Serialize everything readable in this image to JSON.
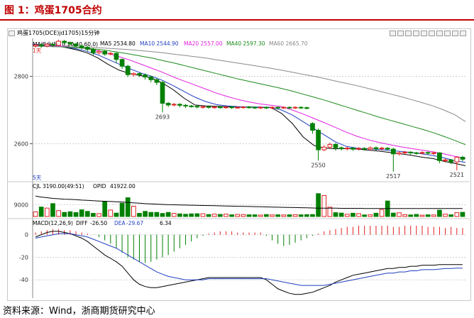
{
  "figure_title": "图 1：鸡蛋1705合约",
  "source_text": "资料来源：Wind，浙商期货研究中心",
  "toolbar": {
    "label": "鸡蛋1705(DCE)jd1705)15分钟"
  },
  "main_panel": {
    "ma_group_label": "MA组合(5,10,20,40,60,0)",
    "ma_items": [
      {
        "label": "MA5 2534.80",
        "color": "#000000"
      },
      {
        "label": "MA10 2544.90",
        "color": "#1f3fbf"
      },
      {
        "label": "MA20 2557.00",
        "color": "#e020e0"
      },
      {
        "label": "MA40 2597.30",
        "color": "#1a8a1a"
      },
      {
        "label": "MA60 2665.70",
        "color": "#8a8a8a"
      }
    ],
    "flag_label": "1天",
    "annotations": [
      "2693",
      "2550",
      "2517",
      "2521"
    ],
    "period_label": "5天"
  },
  "volume_panel": {
    "label": "CJL 3190.00(49:51)",
    "opid_label": "OPID",
    "opid_value": "41922.00"
  },
  "macd_panel": {
    "label": "MACD(12,26,9)",
    "diff_label": "DIFF",
    "diff_value": "-26.50",
    "dea_label": "DEA",
    "dea_value": "-29.67",
    "macd_value": "6.34"
  },
  "colors": {
    "up": "#e02020",
    "down": "#008000",
    "title": "#c00000"
  },
  "chart_data": [
    {
      "type": "candlestick",
      "title": "",
      "y_ticks": [
        2600,
        2800
      ],
      "ylim": [
        2500,
        2900
      ],
      "candles": [
        [
          2890,
          2893,
          2885,
          2896
        ],
        [
          2893,
          2890,
          2884,
          2897
        ],
        [
          2890,
          2895,
          2886,
          2899
        ],
        [
          2895,
          2892,
          2887,
          2898
        ],
        [
          2892,
          2904,
          2890,
          2909
        ],
        [
          2904,
          2900,
          2895,
          2908
        ],
        [
          2900,
          2896,
          2891,
          2903
        ],
        [
          2896,
          2890,
          2885,
          2899
        ],
        [
          2890,
          2886,
          2880,
          2894
        ],
        [
          2886,
          2880,
          2874,
          2890
        ],
        [
          2880,
          2870,
          2863,
          2884
        ],
        [
          2870,
          2874,
          2865,
          2879
        ],
        [
          2874,
          2866,
          2861,
          2878
        ],
        [
          2866,
          2868,
          2862,
          2872
        ],
        [
          2868,
          2850,
          2840,
          2871
        ],
        [
          2850,
          2830,
          2822,
          2853
        ],
        [
          2830,
          2805,
          2798,
          2834
        ],
        [
          2805,
          2808,
          2799,
          2812
        ],
        [
          2808,
          2804,
          2798,
          2811
        ],
        [
          2804,
          2798,
          2790,
          2808
        ],
        [
          2798,
          2790,
          2782,
          2802
        ],
        [
          2790,
          2782,
          2774,
          2794
        ],
        [
          2782,
          2720,
          2693,
          2786
        ],
        [
          2720,
          2715,
          2709,
          2724
        ],
        [
          2715,
          2717,
          2711,
          2721
        ],
        [
          2717,
          2714,
          2708,
          2720
        ],
        [
          2714,
          2712,
          2706,
          2718
        ],
        [
          2712,
          2711,
          2707,
          2715
        ],
        [
          2711,
          2709,
          2705,
          2714
        ],
        [
          2709,
          2710,
          2704,
          2713
        ],
        [
          2710,
          2708,
          2704,
          2713
        ],
        [
          2708,
          2709,
          2704,
          2712
        ],
        [
          2709,
          2708,
          2704,
          2712
        ],
        [
          2708,
          2709,
          2704,
          2712
        ],
        [
          2709,
          2708,
          2703,
          2712
        ],
        [
          2708,
          2708,
          2704,
          2711
        ],
        [
          2708,
          2709,
          2704,
          2712
        ],
        [
          2709,
          2708,
          2704,
          2712
        ],
        [
          2708,
          2707,
          2703,
          2711
        ],
        [
          2707,
          2708,
          2703,
          2711
        ],
        [
          2708,
          2707,
          2703,
          2711
        ],
        [
          2707,
          2708,
          2703,
          2711
        ],
        [
          2708,
          2707,
          2703,
          2711
        ],
        [
          2707,
          2708,
          2703,
          2711
        ],
        [
          2708,
          2707,
          2703,
          2711
        ],
        [
          2707,
          2708,
          2703,
          2711
        ],
        [
          2708,
          2707,
          2703,
          2711
        ],
        [
          2707,
          2706,
          2702,
          2710
        ],
        [
          2660,
          2640,
          2630,
          2664
        ],
        [
          2640,
          2582,
          2550,
          2645
        ],
        [
          2582,
          2590,
          2578,
          2596
        ],
        [
          2590,
          2598,
          2585,
          2603
        ],
        [
          2598,
          2588,
          2580,
          2602
        ],
        [
          2588,
          2585,
          2580,
          2592
        ],
        [
          2585,
          2587,
          2580,
          2591
        ],
        [
          2587,
          2584,
          2579,
          2590
        ],
        [
          2584,
          2586,
          2580,
          2590
        ],
        [
          2586,
          2584,
          2580,
          2590
        ],
        [
          2584,
          2588,
          2580,
          2592
        ],
        [
          2588,
          2585,
          2580,
          2592
        ],
        [
          2585,
          2587,
          2580,
          2591
        ],
        [
          2587,
          2584,
          2580,
          2590
        ],
        [
          2584,
          2570,
          2517,
          2588
        ],
        [
          2570,
          2573,
          2565,
          2578
        ],
        [
          2573,
          2575,
          2568,
          2579
        ],
        [
          2575,
          2573,
          2568,
          2578
        ],
        [
          2573,
          2572,
          2568,
          2576
        ],
        [
          2572,
          2574,
          2568,
          2578
        ],
        [
          2574,
          2572,
          2567,
          2577
        ],
        [
          2572,
          2573,
          2567,
          2577
        ],
        [
          2573,
          2550,
          2542,
          2575
        ],
        [
          2550,
          2552,
          2545,
          2557
        ],
        [
          2552,
          2546,
          2540,
          2555
        ],
        [
          2546,
          2560,
          2521,
          2563
        ],
        [
          2560,
          2554,
          2548,
          2564
        ]
      ],
      "ma_series": [
        {
          "name": "MA5",
          "color": "#000000",
          "values": [
            2895,
            2893,
            2891,
            2886,
            2879,
            2870,
            2855,
            2835,
            2818,
            2808,
            2802,
            2795,
            2780,
            2760,
            2735,
            2715,
            2712,
            2711,
            2710,
            2709,
            2709,
            2708,
            2708,
            2690,
            2660,
            2620,
            2595,
            2587,
            2585,
            2586,
            2584,
            2581,
            2578,
            2574,
            2570,
            2566,
            2560,
            2556,
            2548,
            2542,
            2534.8
          ]
        },
        {
          "name": "MA10",
          "color": "#1f3fbf",
          "values": [
            2894,
            2892,
            2890,
            2887,
            2882,
            2874,
            2864,
            2850,
            2836,
            2822,
            2810,
            2800,
            2788,
            2772,
            2755,
            2738,
            2725,
            2716,
            2712,
            2710,
            2709,
            2709,
            2708,
            2700,
            2685,
            2665,
            2645,
            2625,
            2605,
            2592,
            2587,
            2585,
            2583,
            2580,
            2577,
            2574,
            2570,
            2565,
            2558,
            2550,
            2544.9
          ]
        },
        {
          "name": "MA20",
          "color": "#e020e0",
          "values": [
            2892,
            2891,
            2890,
            2889,
            2886,
            2882,
            2876,
            2868,
            2858,
            2848,
            2836,
            2824,
            2812,
            2798,
            2786,
            2774,
            2762,
            2750,
            2740,
            2731,
            2724,
            2718,
            2714,
            2710,
            2700,
            2688,
            2675,
            2662,
            2648,
            2634,
            2622,
            2612,
            2604,
            2597,
            2591,
            2586,
            2581,
            2576,
            2570,
            2563,
            2557
          ]
        },
        {
          "name": "MA40",
          "color": "#1a8a1a",
          "values": [
            2890,
            2889,
            2888,
            2887,
            2885,
            2883,
            2880,
            2876,
            2871,
            2866,
            2860,
            2854,
            2847,
            2840,
            2832,
            2824,
            2816,
            2808,
            2800,
            2792,
            2785,
            2778,
            2771,
            2764,
            2756,
            2747,
            2738,
            2729,
            2719,
            2709,
            2699,
            2689,
            2679,
            2670,
            2661,
            2652,
            2643,
            2633,
            2622,
            2610,
            2597.3
          ]
        },
        {
          "name": "MA60",
          "color": "#8a8a8a",
          "values": [
            2889,
            2889,
            2888,
            2888,
            2887,
            2886,
            2885,
            2883,
            2881,
            2879,
            2876,
            2873,
            2870,
            2866,
            2862,
            2858,
            2854,
            2849,
            2844,
            2839,
            2834,
            2829,
            2824,
            2818,
            2812,
            2806,
            2800,
            2793,
            2786,
            2779,
            2772,
            2764,
            2756,
            2748,
            2740,
            2731,
            2722,
            2712,
            2700,
            2686,
            2665.7
          ]
        }
      ]
    },
    {
      "type": "bar",
      "title": "",
      "y_ticks": [
        9000
      ],
      "ylim": [
        0,
        20000
      ],
      "volumes": [
        3500,
        7200,
        6400,
        9800,
        4500,
        3100,
        3600,
        3000,
        5100,
        3900,
        2400,
        2200,
        11200,
        4900,
        2600,
        10100,
        14300,
        7800,
        2400,
        3900,
        3100,
        3100,
        2300,
        3100,
        2400,
        2000,
        1700,
        2000,
        2100,
        2100,
        1500,
        1800,
        1600,
        1800,
        1300,
        1600,
        1500,
        1300,
        1300,
        1100,
        1500,
        1200,
        1300,
        1200,
        1300,
        1400,
        1300,
        1400,
        1500,
        17400,
        16000,
        7100,
        2900,
        2600,
        1700,
        2500,
        2200,
        1200,
        1300,
        2500,
        5300,
        11800,
        2600,
        2800,
        1400,
        1200,
        1600,
        1000,
        1300,
        1200,
        4800,
        1800,
        1300,
        2900,
        3190
      ],
      "opid": [
        15500,
        14800,
        14300,
        13800,
        13500,
        13200,
        13000,
        12800,
        12500,
        12300,
        12000,
        11800,
        11600,
        11400,
        11200,
        11000,
        10700,
        10400,
        10100,
        9800,
        9600,
        9400,
        9200,
        9000,
        8900,
        8800,
        8700,
        8600,
        8500,
        8400,
        8300,
        8200,
        8100,
        8000,
        7900,
        7800,
        7700,
        7600,
        7500,
        7400,
        7300,
        7200,
        7100,
        7000,
        6900,
        6800,
        6700,
        6600,
        6500,
        6400,
        6300,
        6300,
        6300,
        6200,
        6200,
        6200,
        6200,
        6100,
        6100,
        6100,
        6100,
        6100,
        6100,
        6100,
        6100,
        6100,
        6100,
        6100,
        6100,
        6100,
        6100,
        6100,
        6100,
        6100,
        6100
      ]
    },
    {
      "type": "line",
      "title": "",
      "y_ticks": [
        0,
        -20,
        -40
      ],
      "ylim": [
        -55,
        8
      ],
      "hist": [
        2,
        3,
        4,
        5,
        5,
        4,
        4,
        3,
        2,
        1,
        0,
        -2,
        -5,
        -8,
        -12,
        -16,
        -20,
        -22,
        -24,
        -25,
        -24,
        -22,
        -20,
        -18,
        -15,
        -12,
        -9,
        -6,
        -3,
        -1,
        1,
        2,
        3,
        3,
        3,
        2,
        2,
        2,
        2,
        2,
        -1,
        -5,
        -8,
        -10,
        -9,
        -7,
        -5,
        -3,
        -1,
        1,
        3,
        4,
        5,
        6,
        7,
        7,
        8,
        8,
        8,
        8,
        8,
        8,
        7,
        7,
        8,
        8,
        8,
        8,
        7,
        7,
        7,
        6,
        7,
        6,
        6
      ],
      "diff": [
        -2,
        0,
        2,
        3,
        3,
        2,
        1,
        -1,
        -3,
        -6,
        -10,
        -14,
        -18,
        -21,
        -24,
        -28,
        -34,
        -40,
        -44,
        -46,
        -47,
        -47,
        -46,
        -45,
        -44,
        -43,
        -42,
        -41,
        -40,
        -39,
        -38,
        -38,
        -38,
        -38,
        -38,
        -38,
        -38,
        -38,
        -38,
        -38,
        -40,
        -44,
        -48,
        -50,
        -52,
        -53,
        -53,
        -52,
        -51,
        -49,
        -47,
        -45,
        -42,
        -40,
        -38,
        -36,
        -35,
        -34,
        -33,
        -32,
        -31,
        -30,
        -30,
        -29,
        -29,
        -28,
        -28,
        -27,
        -27,
        -27,
        -26.5,
        -26.5,
        -26.5,
        -26.5,
        -26.5
      ],
      "dea": [
        -3,
        -2,
        -1,
        0,
        1,
        1,
        1,
        0,
        -1,
        -2,
        -4,
        -6,
        -8,
        -10,
        -12,
        -15,
        -18,
        -21,
        -24,
        -27,
        -30,
        -33,
        -35,
        -37,
        -38,
        -39,
        -40,
        -40,
        -40,
        -40,
        -39,
        -39,
        -39,
        -39,
        -39,
        -39,
        -39,
        -39,
        -39,
        -39,
        -39,
        -40,
        -41,
        -42,
        -43,
        -44,
        -45,
        -45,
        -45,
        -45,
        -45,
        -44,
        -43,
        -42,
        -41,
        -40,
        -39,
        -38,
        -37,
        -36,
        -35,
        -34,
        -34,
        -33,
        -33,
        -32,
        -32,
        -31,
        -31,
        -31,
        -30.5,
        -30,
        -30,
        -29.67,
        -29.67
      ]
    }
  ]
}
